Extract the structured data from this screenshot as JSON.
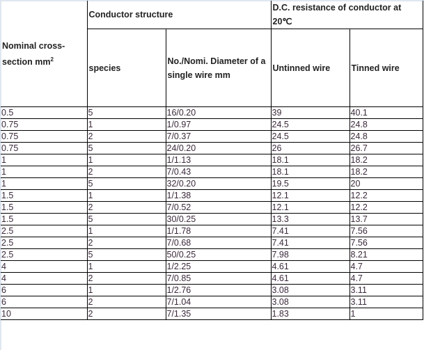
{
  "table": {
    "headers": {
      "nominal_cross_section": "Nominal cross-section mm",
      "nominal_cross_section_sup": "2",
      "conductor_structure": "Conductor structure",
      "dc_resistance": "D.C. resistance of conductor at 20℃",
      "species": "species",
      "diameter": "No./Nomi. Diameter of a single wire mm",
      "untinned": "Untinned wire",
      "tinned": "Tinned wire"
    },
    "rows": [
      [
        "0.5",
        "5",
        "16/0.20",
        "39",
        "40.1"
      ],
      [
        "0.75",
        "1",
        "1/0.97",
        "24.5",
        "24.8"
      ],
      [
        "0.75",
        "2",
        "7/0.37",
        "24.5",
        "24.8"
      ],
      [
        "0.75",
        "5",
        "24/0.20",
        "26",
        "26.7"
      ],
      [
        "1",
        "1",
        "1/1.13",
        "18.1",
        "18.2"
      ],
      [
        "1",
        "2",
        "7/0.43",
        "18.1",
        "18.2"
      ],
      [
        "1",
        "5",
        "32/0.20",
        "19.5",
        "20"
      ],
      [
        "1.5",
        "1",
        "1/1.38",
        "12.1",
        "12.2"
      ],
      [
        "1.5",
        "2",
        "7/0.52",
        "12.1",
        "12.2"
      ],
      [
        "1.5",
        "5",
        "30/0.25",
        "13.3",
        "13.7"
      ],
      [
        "2.5",
        "1",
        "1/1.78",
        "7.41",
        "7.56"
      ],
      [
        "2.5",
        "2",
        "7/0.68",
        "7.41",
        "7.56"
      ],
      [
        "2.5",
        "5",
        "50/0.25",
        "7.98",
        "8.21"
      ],
      [
        "4",
        "1",
        "1/2.25",
        "4.61",
        "4.7"
      ],
      [
        "4",
        "2",
        "7/0.85",
        "4.61",
        "4.7"
      ],
      [
        "6",
        "1",
        "1/2.76",
        "3.08",
        "3.11"
      ],
      [
        "6",
        "2",
        "7/1.04",
        "3.08",
        "3.11"
      ],
      [
        "10",
        "2",
        "7/1.35",
        "1.83",
        "1"
      ]
    ]
  }
}
